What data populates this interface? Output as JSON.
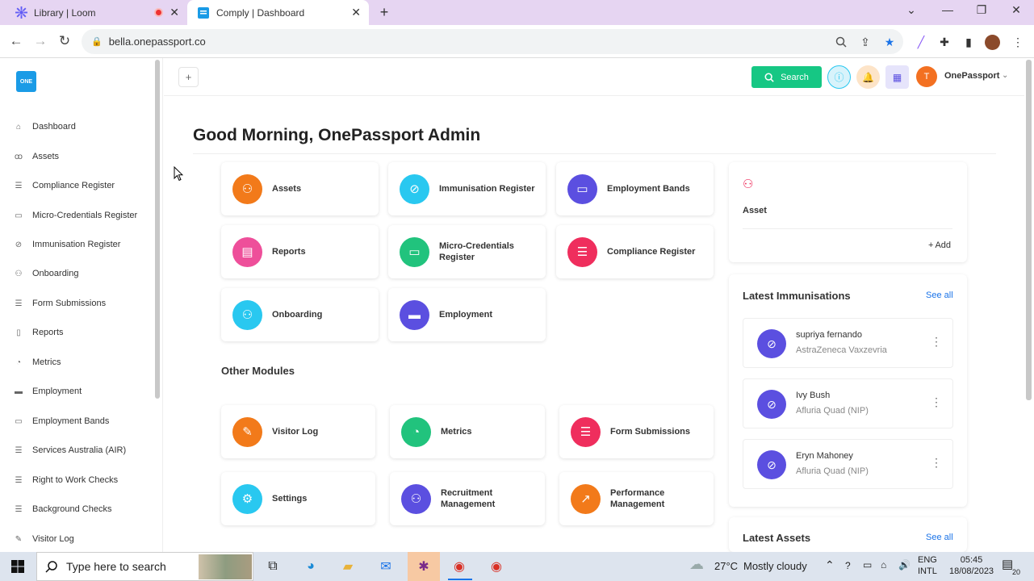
{
  "browser": {
    "tabs": [
      {
        "title": "Library | Loom"
      },
      {
        "title": "Comply | Dashboard"
      }
    ],
    "url": "bella.onepassport.co"
  },
  "sidebar": {
    "logo_text": "ONE",
    "items": [
      {
        "label": "Dashboard",
        "icon": "home-icon"
      },
      {
        "label": "Assets",
        "icon": "users-icon"
      },
      {
        "label": "Compliance Register",
        "icon": "list-icon"
      },
      {
        "label": "Micro-Credentials Register",
        "icon": "certificate-icon"
      },
      {
        "label": "Immunisation Register",
        "icon": "bandage-icon"
      },
      {
        "label": "Onboarding",
        "icon": "user-plus-icon"
      },
      {
        "label": "Form Submissions",
        "icon": "list-icon"
      },
      {
        "label": "Reports",
        "icon": "file-icon"
      },
      {
        "label": "Metrics",
        "icon": "chart-pie-icon"
      },
      {
        "label": "Employment",
        "icon": "briefcase-icon"
      },
      {
        "label": "Employment Bands",
        "icon": "wallet-icon"
      },
      {
        "label": "Services Australia (AIR)",
        "icon": "list-icon"
      },
      {
        "label": "Right to Work Checks",
        "icon": "list-icon"
      },
      {
        "label": "Background Checks",
        "icon": "list-icon"
      },
      {
        "label": "Visitor Log",
        "icon": "pen-icon"
      }
    ]
  },
  "header": {
    "search_label": "Search",
    "avatar_initial": "T",
    "username": "OnePassport"
  },
  "main": {
    "greeting": "Good Morning, OnePassport Admin",
    "modules": [
      {
        "label": "Assets",
        "color": "#f27a1a",
        "icon": "users-icon"
      },
      {
        "label": "Immunisation Register",
        "color": "#29c8f0",
        "icon": "bandage-icon"
      },
      {
        "label": "Employment Bands",
        "color": "#5b4fe0",
        "icon": "wallet-icon"
      },
      {
        "label": "Reports",
        "color": "#ee4f9a",
        "icon": "file-icon"
      },
      {
        "label": "Micro-Credentials Register",
        "color": "#21c37d",
        "icon": "certificate-icon"
      },
      {
        "label": "Compliance Register",
        "color": "#ef2e5d",
        "icon": "list-icon"
      },
      {
        "label": "Onboarding",
        "color": "#29c8f0",
        "icon": "user-plus-icon"
      },
      {
        "label": "Employment",
        "color": "#5b4fe0",
        "icon": "briefcase-icon"
      }
    ],
    "other_modules_title": "Other Modules",
    "other_modules": [
      {
        "label": "Visitor Log",
        "color": "#f27a1a",
        "icon": "pen-icon"
      },
      {
        "label": "Metrics",
        "color": "#21c37d",
        "icon": "chart-pie-icon"
      },
      {
        "label": "Form Submissions",
        "color": "#ef2e5d",
        "icon": "list-icon"
      },
      {
        "label": "Settings",
        "color": "#29c8f0",
        "icon": "gear-icon"
      },
      {
        "label": "Recruitment Management",
        "color": "#5b4fe0",
        "icon": "group-icon"
      },
      {
        "label": "Performance Management",
        "color": "#f27a1a",
        "icon": "trend-icon"
      }
    ]
  },
  "right_panel": {
    "asset_title": "Asset",
    "add_label": "Add",
    "latest_immunisations_title": "Latest Immunisations",
    "see_all": "See all",
    "immunisations": [
      {
        "name": "supriya fernando",
        "vaccine": "AstraZeneca Vaxzevria"
      },
      {
        "name": "Ivy Bush",
        "vaccine": "Afluria Quad (NIP)"
      },
      {
        "name": "Eryn Mahoney",
        "vaccine": "Afluria Quad (NIP)"
      }
    ],
    "latest_assets_title": "Latest Assets"
  },
  "taskbar": {
    "search_placeholder": "Type here to search",
    "weather_temp": "27°C",
    "weather_desc": "Mostly cloudy",
    "lang_line1": "ENG",
    "lang_line2": "INTL",
    "time": "05:45",
    "date": "18/08/2023",
    "notification_count": "20"
  }
}
